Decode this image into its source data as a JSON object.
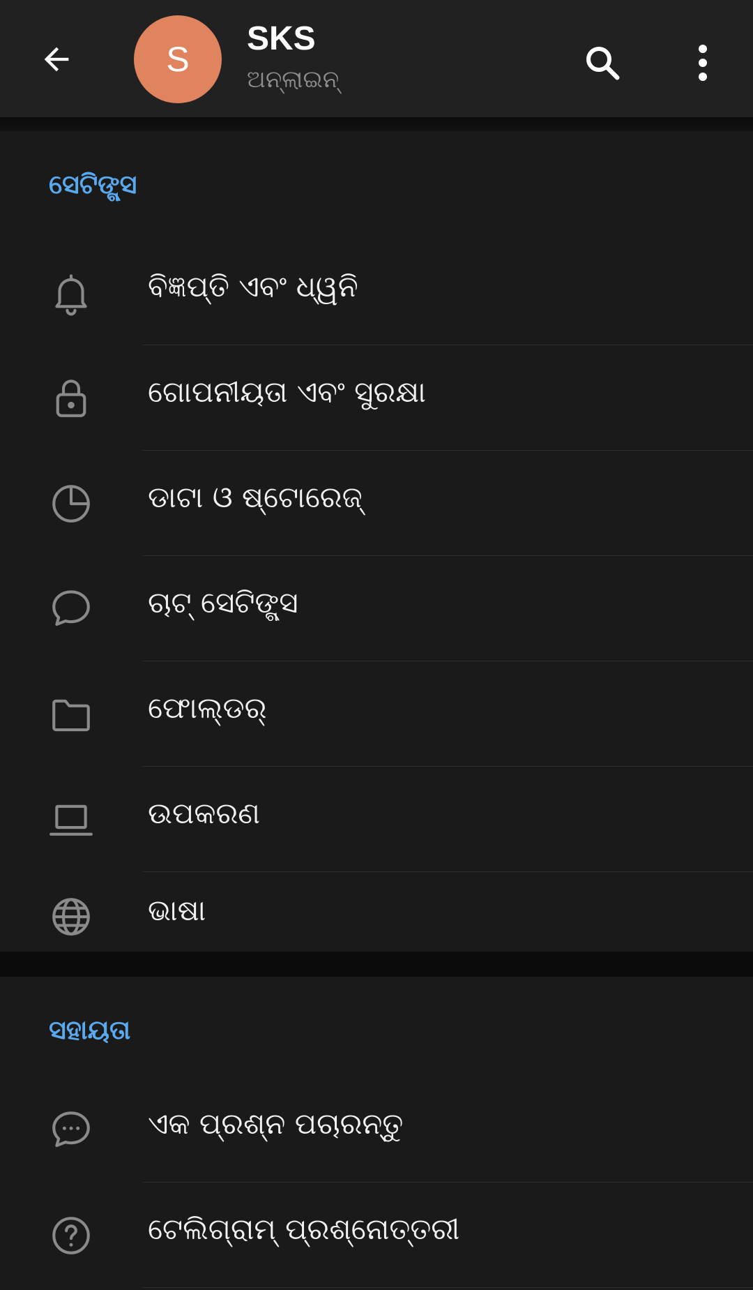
{
  "header": {
    "back_icon": "arrow-left-icon",
    "avatar_letter": "S",
    "avatar_color": "#e0845f",
    "title": "SKS",
    "status": "ଅନ୍‌ଲାଇନ୍",
    "search_icon": "search-icon",
    "menu_icon": "more-vertical-icon"
  },
  "settings": {
    "section_title": "ସେଟିଙ୍ଗ୍ସ",
    "items": [
      {
        "icon": "bell-icon",
        "label": "ବିଜ୍ଞପ୍ତି ଏବଂ ଧ୍ୱନି"
      },
      {
        "icon": "lock-icon",
        "label": "ଗୋପନୀୟତା ଏବଂ ସୁରକ୍ଷା"
      },
      {
        "icon": "pie-chart-icon",
        "label": "ଡାଟା ଓ ଷ୍ଟୋରେଜ୍"
      },
      {
        "icon": "chat-bubble-icon",
        "label": "ଚାଟ୍ ସେଟିଙ୍ଗ୍ସ"
      },
      {
        "icon": "folder-icon",
        "label": "ଫୋଲ୍ଡର୍"
      },
      {
        "icon": "laptop-icon",
        "label": "ଉପକରଣ"
      },
      {
        "icon": "globe-icon",
        "label": "ଭାଷା"
      }
    ]
  },
  "help": {
    "section_title": "ସହାୟତା",
    "items": [
      {
        "icon": "chat-dots-icon",
        "label": "ଏକ ପ୍ରଶ୍ନ ପଚାରନ୍ତୁ"
      },
      {
        "icon": "help-circle-icon",
        "label": "ଟେଲିଗ୍ରାମ୍ ପ୍ରଶ୍ନୋତ୍ତରୀ"
      }
    ]
  },
  "colors": {
    "accent": "#5aa9ee",
    "background": "#1a1a1a",
    "header": "#212121"
  }
}
